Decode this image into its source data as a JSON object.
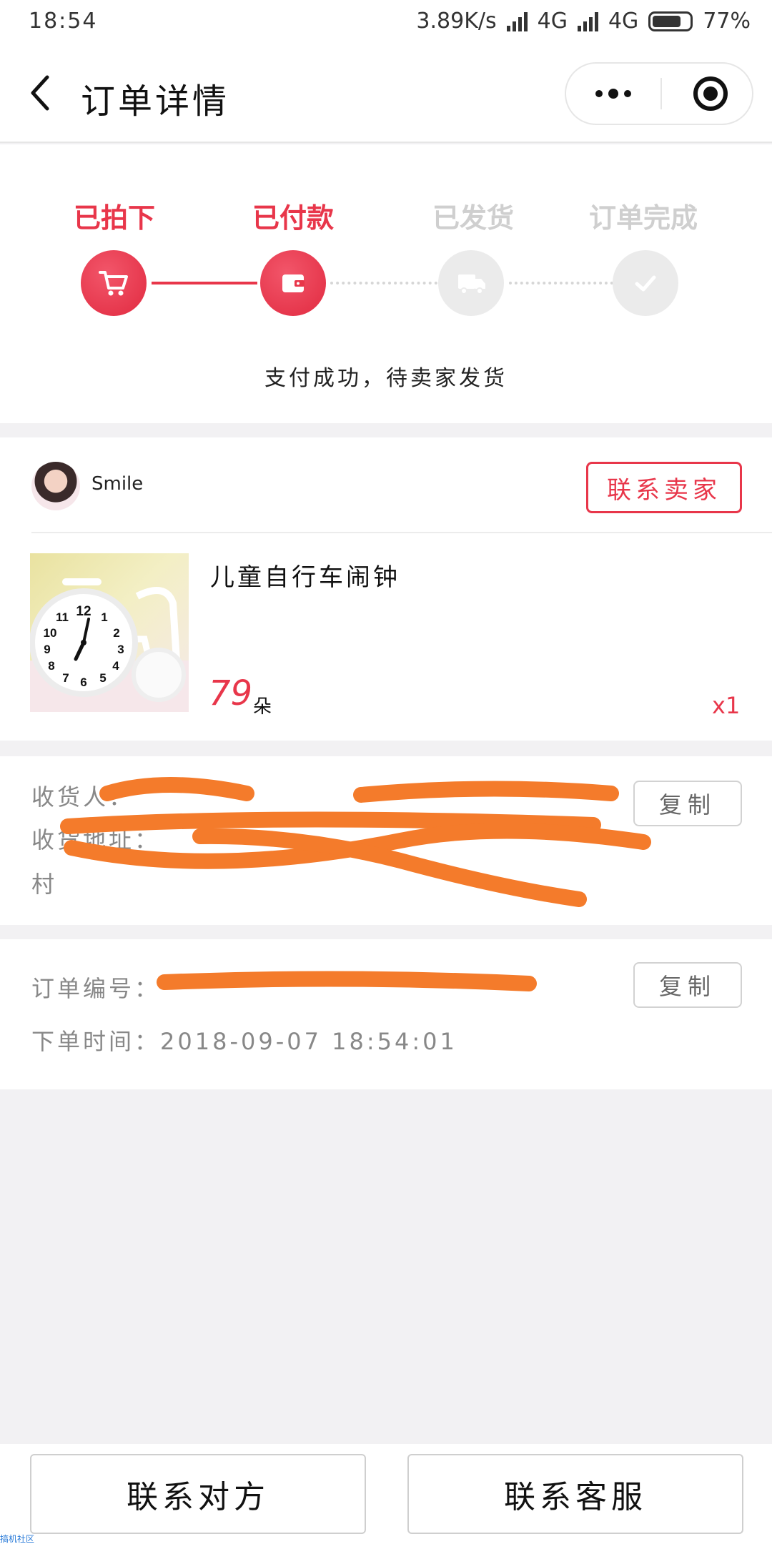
{
  "status_bar": {
    "time": "18:54",
    "network_speed": "3.89K/s",
    "network_1": "4G",
    "network_2": "4G",
    "battery": "77%",
    "battery_level": 0.77
  },
  "nav": {
    "title": "订单详情"
  },
  "progress": {
    "steps": [
      {
        "label": "已拍下",
        "done": true,
        "icon": "cart-icon"
      },
      {
        "label": "已付款",
        "done": true,
        "icon": "wallet-icon"
      },
      {
        "label": "已发货",
        "done": false,
        "icon": "truck-icon"
      },
      {
        "label": "订单完成",
        "done": false,
        "icon": "check-icon"
      }
    ],
    "status_text": "支付成功，待卖家发货"
  },
  "seller": {
    "name": "Smile",
    "contact_label": "联系卖家"
  },
  "product": {
    "title": "儿童自行车闹钟",
    "price": "79",
    "price_unit": "朵",
    "quantity": "x1"
  },
  "address": {
    "receiver_label": "收货人：",
    "address_label": "收货地址：",
    "address_tail": "村",
    "copy_label": "复制"
  },
  "order": {
    "number_label": "订单编号：",
    "time_line": "下单时间：2018-09-07 18:54:01",
    "copy_label": "复制"
  },
  "bottom": {
    "contact_other": "联系对方",
    "contact_service": "联系客服"
  },
  "watermark": "搞机社区",
  "colors": {
    "accent": "#e8364a",
    "inactive": "#cfcfcf",
    "redaction": "#f47b2b",
    "background": "#f2f1f3"
  }
}
